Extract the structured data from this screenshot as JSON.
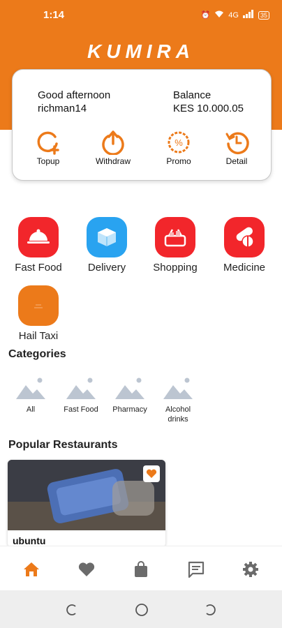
{
  "status": {
    "time": "1:14",
    "signal_text": "4G",
    "battery": "35"
  },
  "brand": {
    "logo": "KUMIRA",
    "accent": "#ec7a1a"
  },
  "account": {
    "greeting": "Good afternoon",
    "username": "richman14",
    "balance_label": "Balance",
    "balance_value": "KES 10.000.05"
  },
  "quick_actions": [
    {
      "label": "Topup",
      "icon": "topup-icon"
    },
    {
      "label": "Withdraw",
      "icon": "withdraw-icon"
    },
    {
      "label": "Promo",
      "icon": "promo-icon"
    },
    {
      "label": "Detail",
      "icon": "history-icon"
    }
  ],
  "services": [
    {
      "label": "Fast Food",
      "icon": "food-cloche-icon",
      "color": "#f2262b"
    },
    {
      "label": "Delivery",
      "icon": "package-icon",
      "color": "#29a3f0"
    },
    {
      "label": "Shopping",
      "icon": "basket-icon",
      "color": "#f2262b"
    },
    {
      "label": "Medicine",
      "icon": "pills-icon",
      "color": "#f2262b"
    },
    {
      "label": "Hail Taxi",
      "icon": "taxi-icon",
      "color": "#ec7a1a"
    }
  ],
  "categories": {
    "title": "Categories",
    "items": [
      "All",
      "Fast Food",
      "Pharmacy",
      "Alcohol drinks"
    ]
  },
  "popular": {
    "title": "Popular Restaurants",
    "items": [
      {
        "name": "ubuntu"
      }
    ]
  },
  "bottom_nav": [
    "home-icon",
    "heart-icon",
    "bag-icon",
    "chat-icon",
    "gear-icon"
  ]
}
